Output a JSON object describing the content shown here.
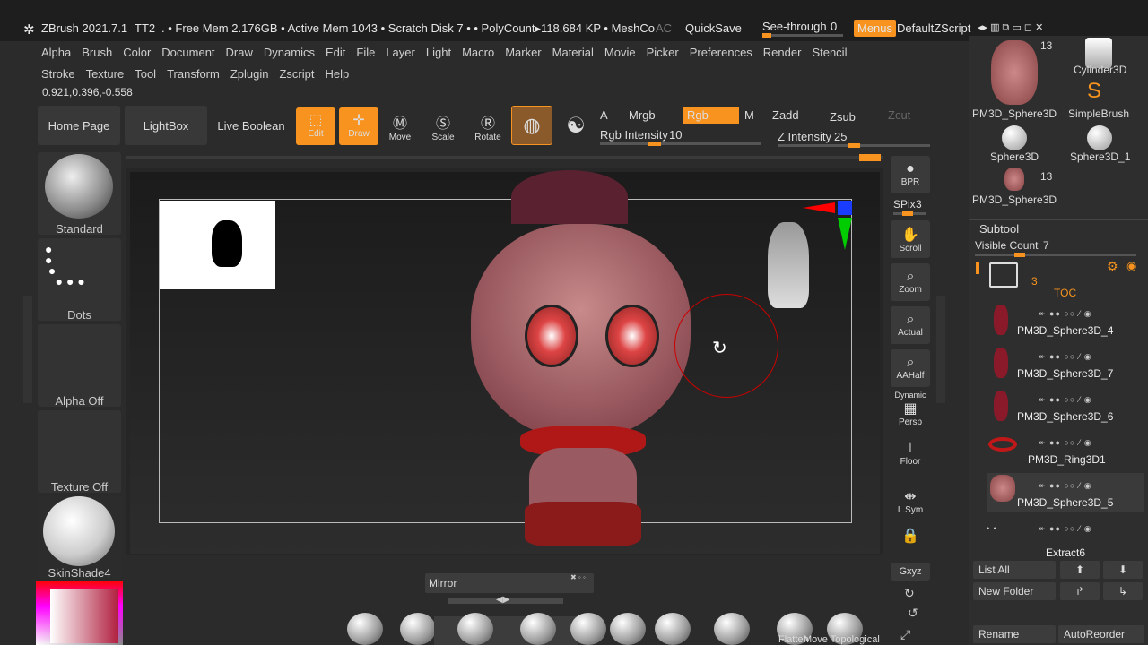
{
  "title": {
    "app": "ZBrush 2021.7.1",
    "doc": "TT2",
    "status": ". • Free Mem 2.176GB • Active Mem 1043 • Scratch Disk 7 • • PolyCount▸118.684 KP • MeshCo",
    "ac": "AC",
    "quicksave": "QuickSave",
    "see_through_label": "See-through",
    "see_through_value": "0",
    "menus": "Menus",
    "default_zscript": "DefaultZScript"
  },
  "menubar1": [
    "Alpha",
    "Brush",
    "Color",
    "Document",
    "Draw",
    "Dynamics",
    "Edit",
    "File",
    "Layer",
    "Light",
    "Macro",
    "Marker",
    "Material",
    "Movie",
    "Picker",
    "Preferences",
    "Render",
    "Stencil"
  ],
  "menubar2": [
    "Stroke",
    "Texture",
    "Tool",
    "Transform",
    "Zplugin",
    "Zscript",
    "Help"
  ],
  "coords": "0.921,0.396,-0.558",
  "toolbar": {
    "home_page": "Home Page",
    "lightbox": "LightBox",
    "live_boolean": "Live Boolean",
    "edit": "Edit",
    "draw": "Draw",
    "move": "Move",
    "scale": "Scale",
    "rotate": "Rotate",
    "a": "A",
    "mrgb": "Mrgb",
    "rgb": "Rgb",
    "m": "M",
    "zadd": "Zadd",
    "zsub": "Zsub",
    "zcut": "Zcut",
    "rgb_intensity_label": "Rgb Intensity",
    "rgb_intensity_value": "10",
    "z_intensity_label": "Z Intensity",
    "z_intensity_value": "25"
  },
  "left_panel": {
    "brush": "Standard",
    "stroke": "Dots",
    "alpha": "Alpha Off",
    "texture": "Texture Off",
    "material": "SkinShade4"
  },
  "right_toolbar": {
    "bpr": "BPR",
    "spix_label": "SPix",
    "spix_value": "3",
    "scroll": "Scroll",
    "zoom": "Zoom",
    "actual": "Actual",
    "aahalf": "AAHalf",
    "dynamic": "Dynamic",
    "persp": "Persp",
    "floor": "Floor",
    "lsym": "L.Sym",
    "xyz": "Gxyz"
  },
  "tools": [
    {
      "name": "PM3D_Sphere3D",
      "count": "13"
    },
    {
      "name": "Cylinder3D"
    },
    {
      "name": "SimpleBrush"
    },
    {
      "name": "Sphere3D"
    },
    {
      "name": "Sphere3D_1"
    },
    {
      "name": "PM3D_Sphere3D",
      "count": "13"
    }
  ],
  "subtool": {
    "header": "Subtool",
    "visible_count_label": "Visible Count",
    "visible_count_value": "7",
    "folder_count": "3",
    "folder_name": "TOC",
    "items": [
      "PM3D_Sphere3D_4",
      "PM3D_Sphere3D_7",
      "PM3D_Sphere3D_6",
      "PM3D_Ring3D1",
      "PM3D_Sphere3D_5",
      "Extract6"
    ],
    "list_all": "List All",
    "new_folder": "New Folder",
    "rename": "Rename",
    "auto_reorder": "AutoReorder"
  },
  "bottom": {
    "mirror": "Mirror",
    "brushes": [
      "Flatten",
      "Move Topological"
    ]
  },
  "colors": {
    "accent": "#f7931e",
    "bg": "#2b2b2b",
    "panel": "#333333"
  }
}
